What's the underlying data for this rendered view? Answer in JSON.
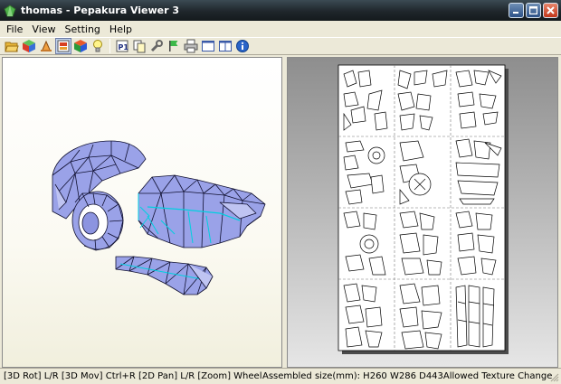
{
  "window": {
    "title": "thomas - Pepakura Viewer 3"
  },
  "menu": {
    "items": [
      "File",
      "View",
      "Setting",
      "Help"
    ]
  },
  "toolbar": {
    "buttons": [
      "open-folder-icon",
      "cube-icon",
      "unfold-icon",
      "print-layout-icon",
      "texture-cube-icon",
      "lightbulb-icon",
      "page-number-icon",
      "copy-icon",
      "wrench-icon",
      "flag-icon",
      "printer-icon",
      "single-view-icon",
      "split-view-icon",
      "info-icon"
    ],
    "active": "print-layout-icon"
  },
  "status": {
    "left": "[3D Rot] L/R [3D Mov] Ctrl+R [2D Pan] L/R [Zoom] Wheel",
    "right": "Assembled size(mm): H260 W286 D443Allowed Texture Change"
  },
  "colors": {
    "titlebar": "#1f262b",
    "model_fill": "#9aa2e8",
    "fold_lines": "#00d0e0",
    "page": "#ffffff"
  }
}
